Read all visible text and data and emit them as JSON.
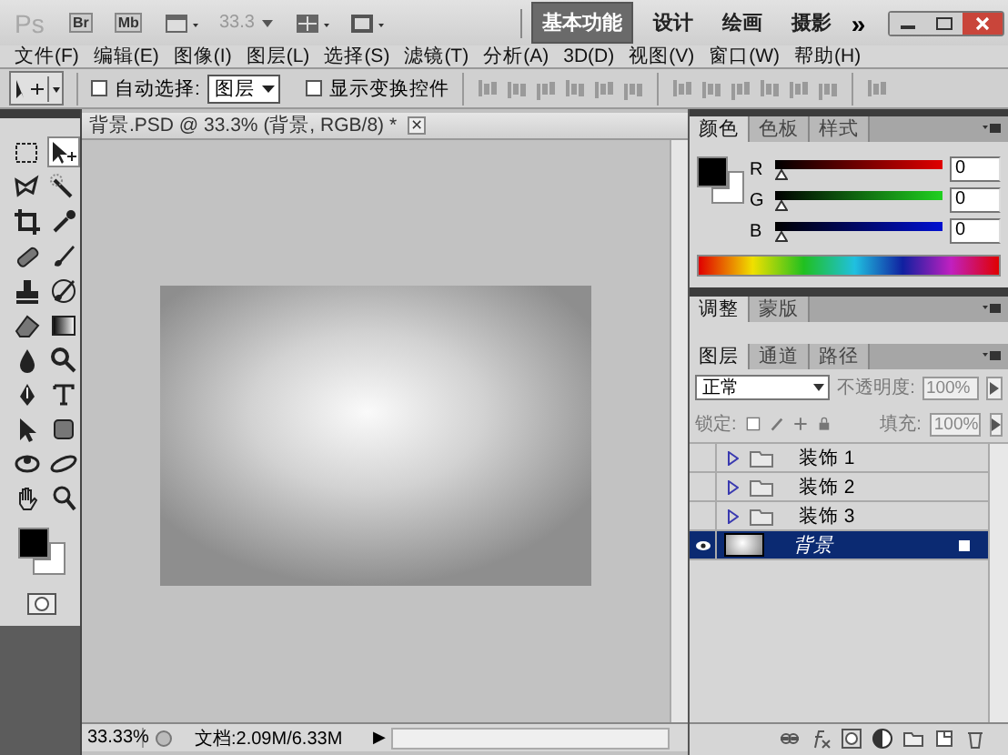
{
  "app_bar": {
    "logo": "Ps",
    "bridge": "Br",
    "mini_bridge": "Mb",
    "zoom": "33.3",
    "workspaces": [
      {
        "label": "基本功能",
        "selected": true
      },
      {
        "label": "设计",
        "selected": false
      },
      {
        "label": "绘画",
        "selected": false
      },
      {
        "label": "摄影",
        "selected": false
      }
    ],
    "more": "»"
  },
  "menu": [
    "文件(F)",
    "编辑(E)",
    "图像(I)",
    "图层(L)",
    "选择(S)",
    "滤镜(T)",
    "分析(A)",
    "3D(D)",
    "视图(V)",
    "窗口(W)",
    "帮助(H)"
  ],
  "options_bar": {
    "auto_select": {
      "label": "自动选择:",
      "checked": false
    },
    "target": "图层",
    "transform_controls": {
      "label": "显示变换控件",
      "checked": false
    },
    "align_disabled": true
  },
  "tools": [
    {
      "kind": "marquee",
      "selected": false
    },
    {
      "kind": "move",
      "selected": true
    },
    {
      "kind": "lasso",
      "selected": false
    },
    {
      "kind": "wand",
      "selected": false
    },
    {
      "kind": "crop",
      "selected": false
    },
    {
      "kind": "eyedropper",
      "selected": false
    },
    {
      "kind": "healing",
      "selected": false
    },
    {
      "kind": "brush",
      "selected": false
    },
    {
      "kind": "stamp",
      "selected": false
    },
    {
      "kind": "history",
      "selected": false
    },
    {
      "kind": "eraser",
      "selected": false
    },
    {
      "kind": "gradient",
      "selected": false
    },
    {
      "kind": "drop",
      "selected": false
    },
    {
      "kind": "dodge",
      "selected": false
    },
    {
      "kind": "pen",
      "selected": false
    },
    {
      "kind": "type",
      "selected": false
    },
    {
      "kind": "pointer",
      "selected": false
    },
    {
      "kind": "shape",
      "selected": false
    },
    {
      "kind": "rotate3d",
      "selected": false
    },
    {
      "kind": "orbit3d",
      "selected": false
    },
    {
      "kind": "hand",
      "selected": false
    },
    {
      "kind": "zoom",
      "selected": false
    }
  ],
  "document": {
    "tab": "背景.PSD @ 33.3% (背景, RGB/8) *",
    "close": "×",
    "zoom": "33.33%",
    "info": "文档:2.09M/6.33M",
    "menu_arrow": "▶"
  },
  "color_panel": {
    "tabs": [
      {
        "label": "颜色",
        "selected": true
      },
      {
        "label": "色板",
        "selected": false
      },
      {
        "label": "样式",
        "selected": false
      }
    ],
    "channels": [
      {
        "name": "R",
        "value": "0",
        "level": 0,
        "kind": "red"
      },
      {
        "name": "G",
        "value": "0",
        "level": 0,
        "kind": "green"
      },
      {
        "name": "B",
        "value": "0",
        "level": 0,
        "kind": "blue"
      }
    ]
  },
  "adjust_panel": {
    "tabs": [
      {
        "label": "调整",
        "selected": true
      },
      {
        "label": "蒙版",
        "selected": false
      }
    ]
  },
  "layers_panel": {
    "tabs": [
      {
        "label": "图层",
        "selected": true
      },
      {
        "label": "通道",
        "selected": false
      },
      {
        "label": "路径",
        "selected": false
      }
    ],
    "blend_mode": "正常",
    "opacity_label": "不透明度:",
    "opacity": "100%",
    "lock_label": "锁定:",
    "fill_label": "填充:",
    "fill": "100%",
    "layers": [
      {
        "name": "装饰 1",
        "kind": "group",
        "visible": false,
        "selected": false,
        "expanded": false
      },
      {
        "name": "装饰 2",
        "kind": "group",
        "visible": false,
        "selected": false,
        "expanded": false
      },
      {
        "name": "装饰 3",
        "kind": "group",
        "visible": false,
        "selected": false,
        "expanded": false
      },
      {
        "name": "背景",
        "kind": "image",
        "visible": true,
        "selected": true
      }
    ]
  }
}
